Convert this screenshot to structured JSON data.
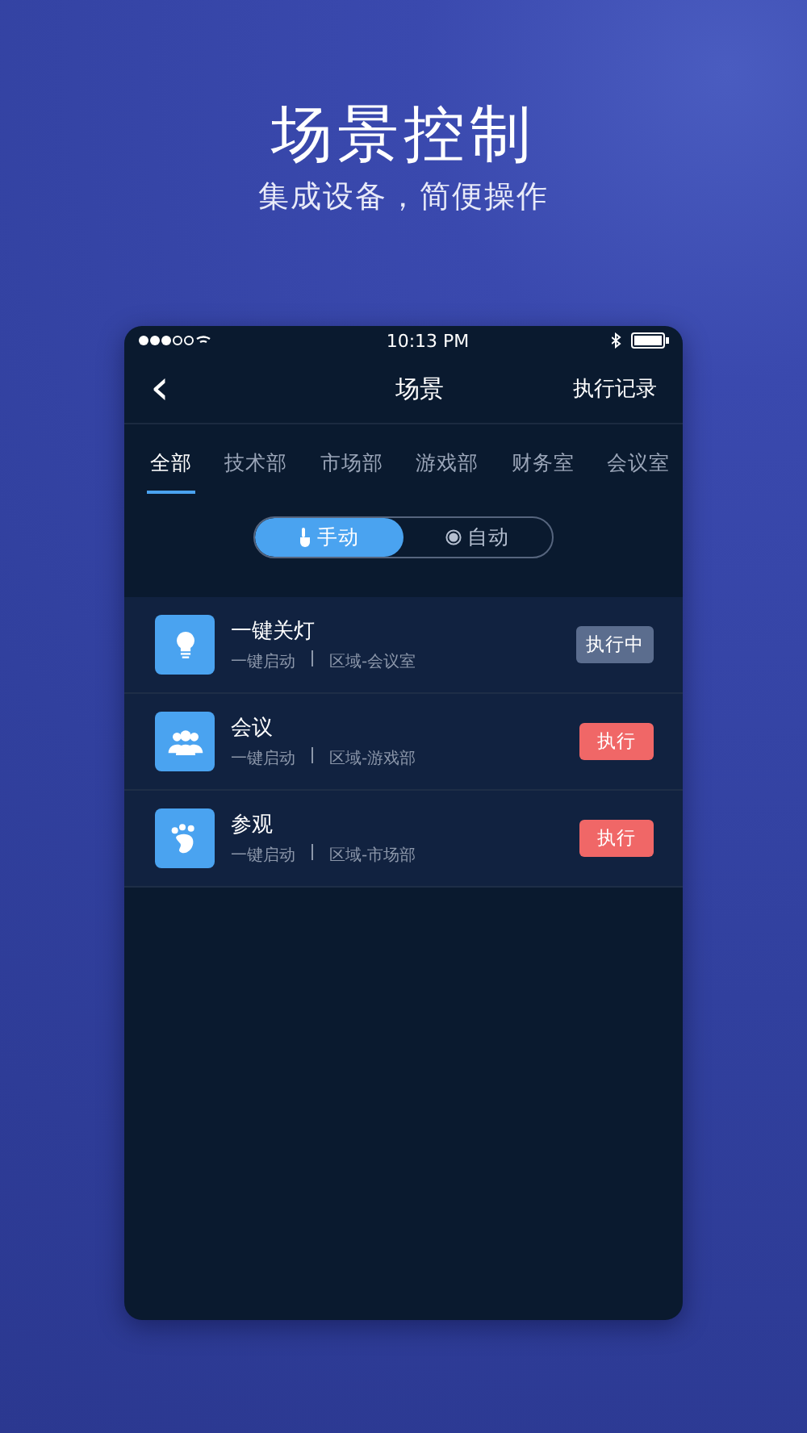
{
  "hero": {
    "title": "场景控制",
    "subtitle": "集成设备，简便操作"
  },
  "status_bar": {
    "time": "10:13 PM"
  },
  "nav": {
    "back": "‹",
    "title": "场景",
    "action": "执行记录"
  },
  "tabs": [
    {
      "label": "全部",
      "selected": true
    },
    {
      "label": "技术部",
      "selected": false
    },
    {
      "label": "市场部",
      "selected": false
    },
    {
      "label": "游戏部",
      "selected": false
    },
    {
      "label": "财务室",
      "selected": false
    },
    {
      "label": "会议室",
      "selected": false
    }
  ],
  "mode_toggle": [
    {
      "label": "手动",
      "kind": "hand",
      "selected": true
    },
    {
      "label": "自动",
      "kind": "dot",
      "selected": false
    }
  ],
  "scenes": [
    {
      "name": "一键关灯",
      "kind": "bulb",
      "trigger": "一键启动",
      "area": "区域-会议室",
      "button": "执行中",
      "running": true
    },
    {
      "name": "会议",
      "kind": "people",
      "trigger": "一键启动",
      "area": "区域-游戏部",
      "button": "执行",
      "running": false
    },
    {
      "name": "参观",
      "kind": "foot",
      "trigger": "一键启动",
      "area": "区域-市场部",
      "button": "执行",
      "running": false
    }
  ]
}
